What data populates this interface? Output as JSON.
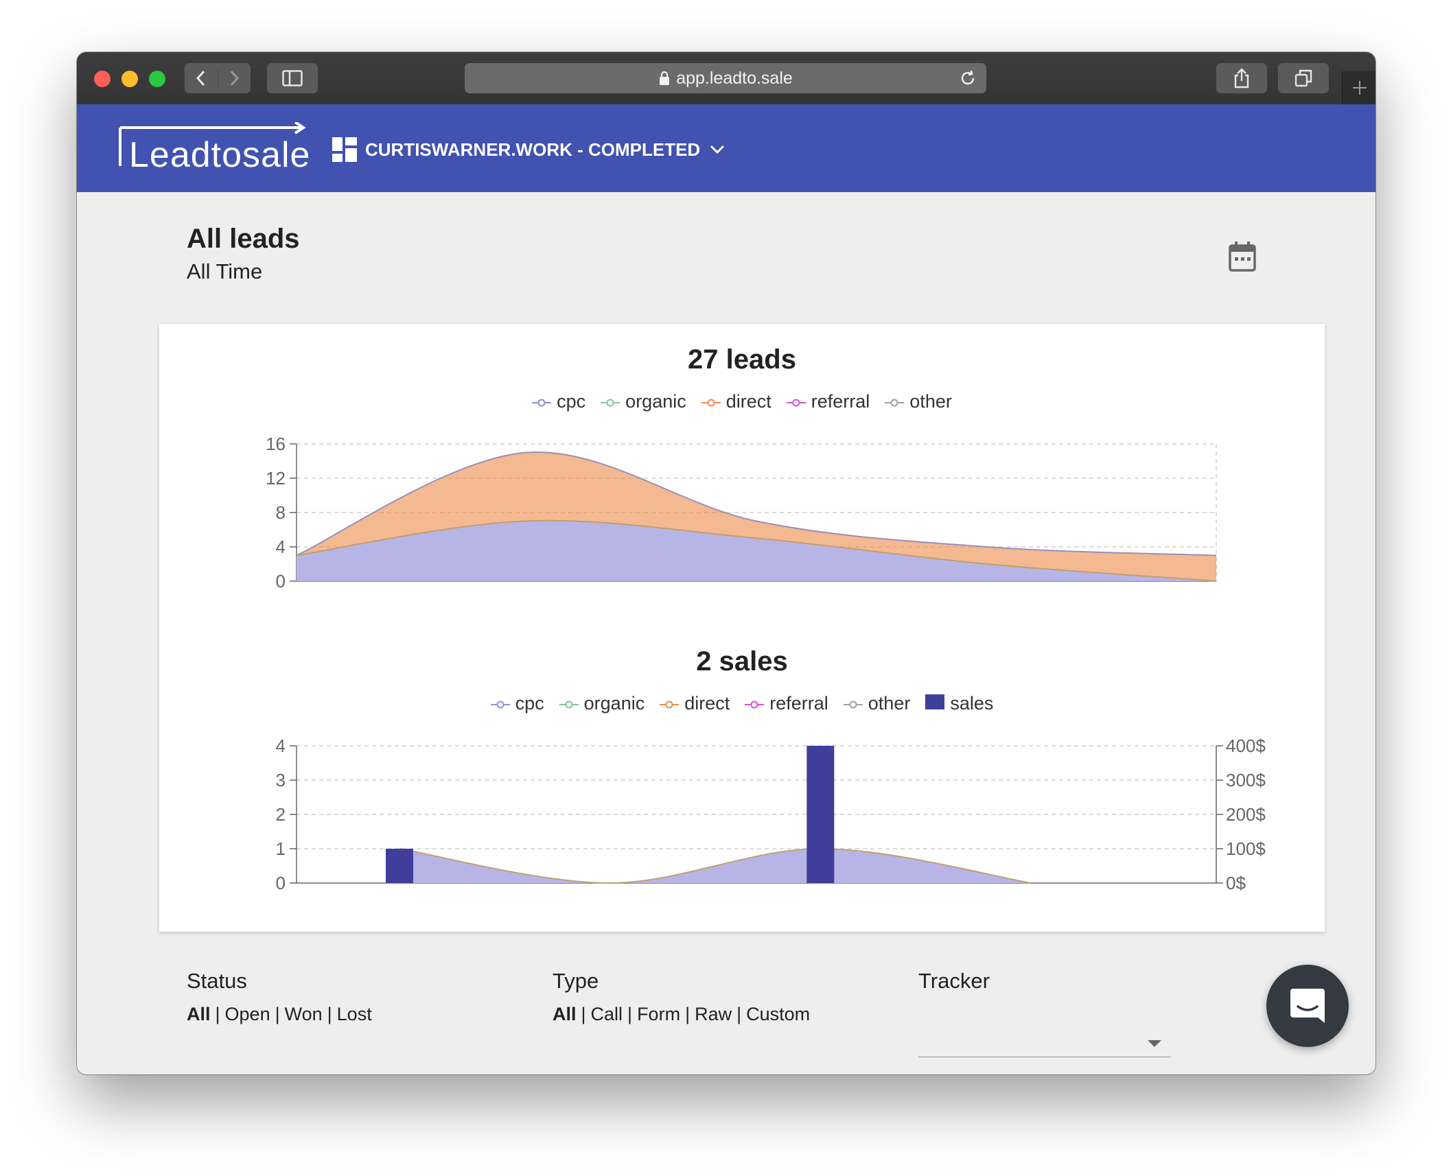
{
  "browser": {
    "url": "app.leadto.sale"
  },
  "header": {
    "logo": "Leadtosale",
    "project": "CURTISWARNER.WORK - COMPLETED"
  },
  "page": {
    "title": "All leads",
    "period": "All Time"
  },
  "leads_chart": {
    "title": "27 leads",
    "legend": [
      "cpc",
      "organic",
      "direct",
      "referral",
      "other"
    ],
    "yticks": [
      "0",
      "4",
      "8",
      "12",
      "16"
    ]
  },
  "sales_chart": {
    "title": "2 sales",
    "legend": [
      "cpc",
      "organic",
      "direct",
      "referral",
      "other",
      "sales"
    ],
    "yticks": [
      "0",
      "1",
      "2",
      "3",
      "4"
    ],
    "y2ticks": [
      "0$",
      "100$",
      "200$",
      "300$",
      "400$"
    ]
  },
  "filters": {
    "status": {
      "label": "Status",
      "options": [
        "All",
        "Open",
        "Won",
        "Lost"
      ],
      "selected": "All"
    },
    "type": {
      "label": "Type",
      "options": [
        "All",
        "Call",
        "Form",
        "Raw",
        "Custom"
      ],
      "selected": "All"
    },
    "tracker": {
      "label": "Tracker",
      "value": ""
    }
  },
  "chart_data": [
    {
      "type": "area",
      "title": "27 leads",
      "stacked": true,
      "ylim": [
        0,
        16
      ],
      "grid": true,
      "legend_position": "top",
      "x": [
        0,
        1,
        2,
        3,
        4
      ],
      "series": [
        {
          "name": "cpc",
          "color": "#8b8ee0",
          "values": [
            3,
            7,
            5,
            2,
            0
          ]
        },
        {
          "name": "direct",
          "color": "#ed8b48",
          "values": [
            0,
            8,
            2,
            2,
            3
          ]
        }
      ]
    },
    {
      "type": "bar",
      "title": "2 sales",
      "ylim": [
        0,
        4
      ],
      "y2lim": [
        0,
        400
      ],
      "grid": true,
      "legend_position": "top",
      "x": [
        0,
        1,
        2,
        3,
        4
      ],
      "series": [
        {
          "name": "cpc",
          "type": "area",
          "color": "#8b8ee0",
          "values": [
            1,
            0,
            1,
            0,
            0
          ]
        },
        {
          "name": "sales",
          "type": "bar",
          "axis": "right",
          "color": "#3f3f9b",
          "values": [
            100,
            0,
            400,
            0,
            0
          ]
        }
      ]
    }
  ],
  "colors": {
    "cpc": "#8b8ee0",
    "organic": "#86c29a",
    "direct": "#ed8b48",
    "referral": "#d64fd2",
    "other": "#a0a0a0",
    "sales": "#3f3f9b",
    "header": "#4152b0"
  }
}
